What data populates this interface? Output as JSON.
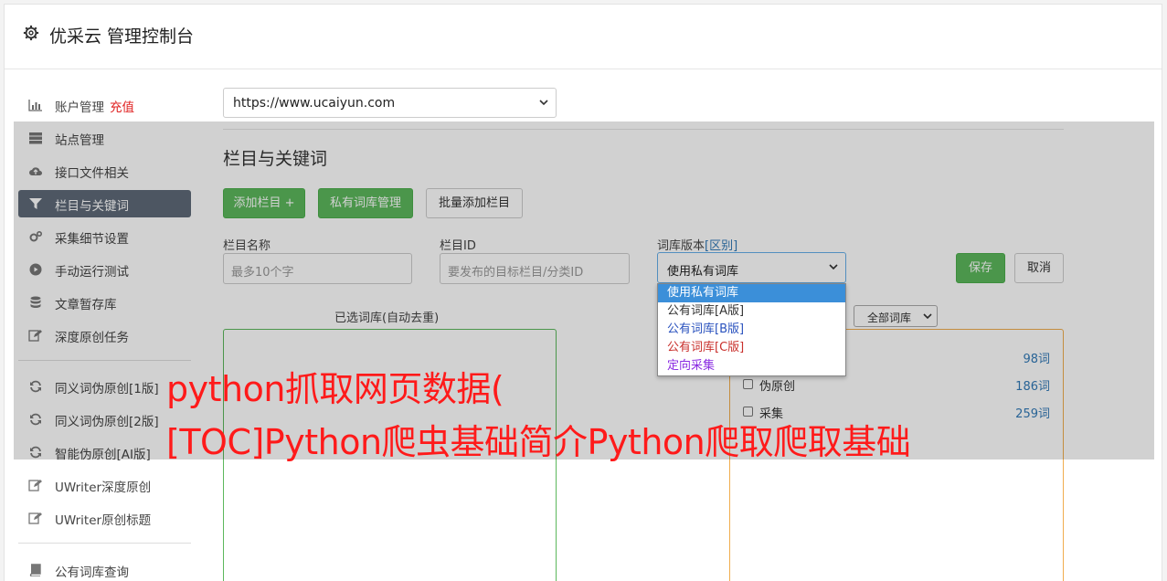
{
  "header": {
    "title": "优采云 管理控制台"
  },
  "sidebar": {
    "items": [
      {
        "label": "账户管理",
        "accent": "充值",
        "icon": "bar-chart-icon"
      },
      {
        "label": "站点管理",
        "icon": "server-icon"
      },
      {
        "label": "接口文件相关",
        "icon": "cloud-upload-icon"
      },
      {
        "label": "栏目与关键词",
        "icon": "filter-icon",
        "active": true
      },
      {
        "label": "采集细节设置",
        "icon": "cogs-icon"
      },
      {
        "label": "手动运行测试",
        "icon": "play-circle-icon"
      },
      {
        "label": "文章暂存库",
        "icon": "database-icon"
      },
      {
        "label": "深度原创任务",
        "icon": "edit-icon"
      },
      {
        "label": "同义词伪原创[1版]",
        "icon": "refresh-icon"
      },
      {
        "label": "同义词伪原创[2版]",
        "icon": "refresh-icon"
      },
      {
        "label": "智能伪原创[AI版]",
        "icon": "refresh-icon"
      },
      {
        "label": "UWriter深度原创",
        "icon": "edit-icon"
      },
      {
        "label": "UWriter原创标题",
        "icon": "edit-icon"
      },
      {
        "label": "公有词库查询",
        "icon": "book-icon"
      }
    ]
  },
  "site_select": {
    "value": "https://www.ucaiyun.com"
  },
  "section": {
    "title": "栏目与关键词"
  },
  "buttons": {
    "add_column": "添加栏目 +",
    "private_lib": "私有词库管理",
    "batch_add": "批量添加栏目",
    "save": "保存",
    "cancel": "取消"
  },
  "form": {
    "name_label": "栏目名称",
    "name_placeholder": "最多10个字",
    "id_label": "栏目ID",
    "id_placeholder": "要发布的目标栏目/分类ID",
    "lib_label": "词库版本",
    "lib_link": "[区别]",
    "lib_value": "使用私有词库"
  },
  "dropdown": {
    "options": [
      {
        "label": "使用私有词库",
        "color": "#ffffff",
        "selected": true
      },
      {
        "label": "公有词库[A版]",
        "color": "#333333"
      },
      {
        "label": "公有词库[B版]",
        "color": "#2a52be"
      },
      {
        "label": "公有词库[C版]",
        "color": "#c9302c"
      },
      {
        "label": "定向采集",
        "color": "#8a2be2"
      }
    ]
  },
  "selected_box": {
    "title": "已选词库(自动去重)"
  },
  "library_filter": {
    "value": "全部词库"
  },
  "libraries": [
    {
      "name": "",
      "count": "98词"
    },
    {
      "name": "伪原创",
      "count": "186词"
    },
    {
      "name": "采集",
      "count": "259词"
    }
  ],
  "overlay": {
    "line1": "python抓取网页数据(",
    "line2": "[TOC]Python爬虫基础简介Python爬取爬取基础"
  },
  "colors": {
    "accent": "#5cb85c",
    "active_nav": "#5e6a78",
    "overlay_text": "#ff1a1a"
  }
}
